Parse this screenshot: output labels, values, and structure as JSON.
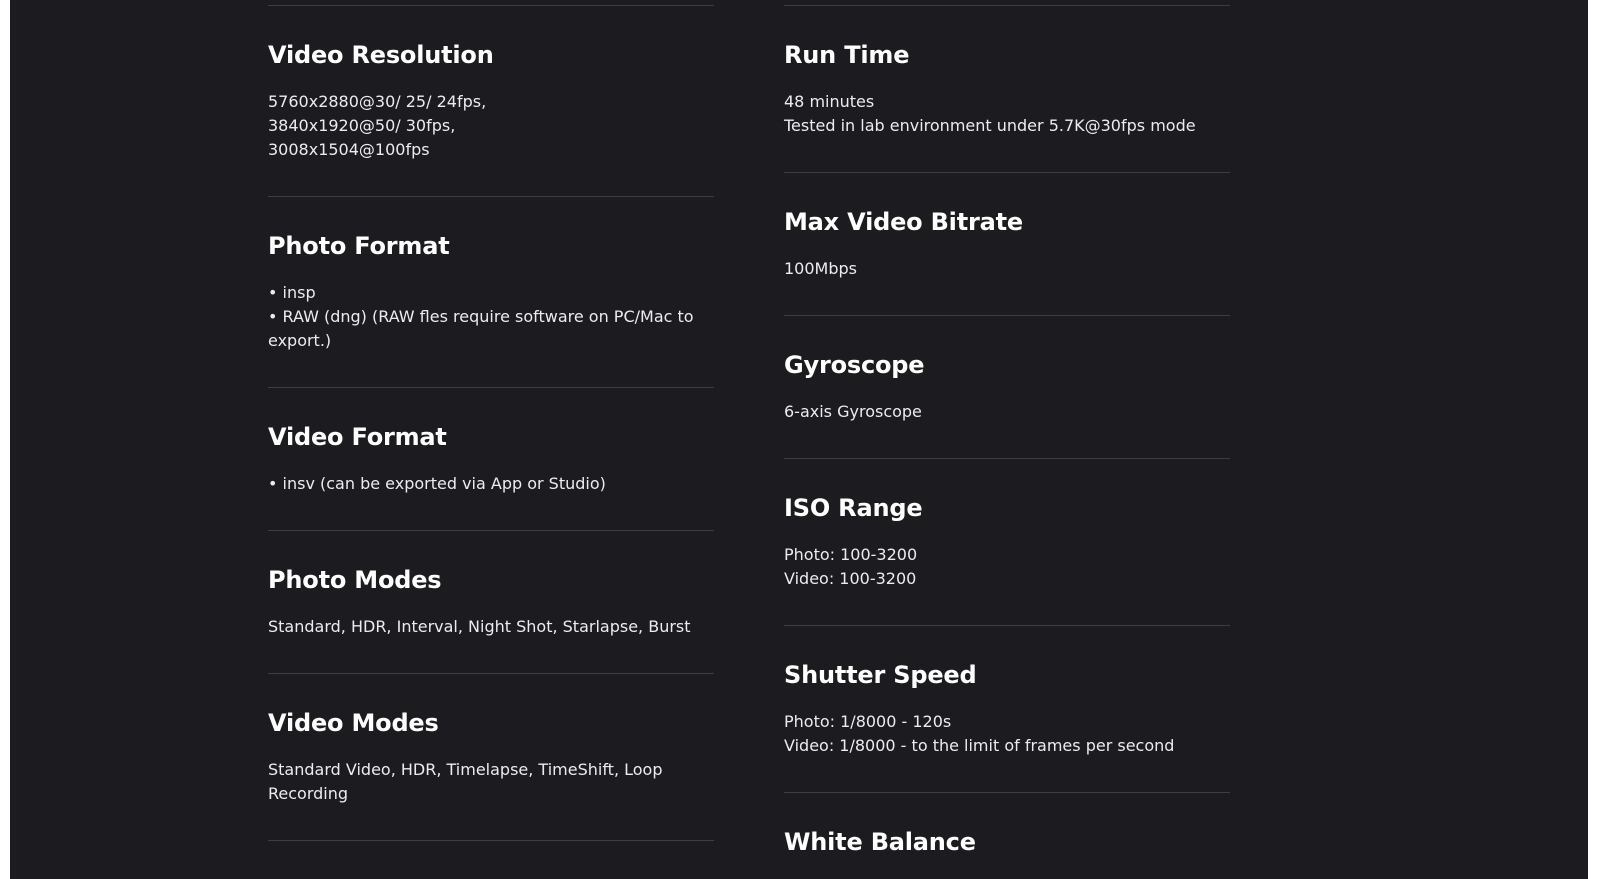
{
  "left_column": [
    {
      "title": "Video Resolution",
      "lines": [
        "5760x2880@30/ 25/ 24fps,",
        "3840x1920@50/ 30fps,",
        "3008x1504@100fps"
      ]
    },
    {
      "title": "Photo Format",
      "lines": [
        "• insp",
        "• RAW (dng) (RAW fles require software on PC/Mac to",
        "export.)"
      ]
    },
    {
      "title": "Video Format",
      "lines": [
        "• insv (can be exported via App or Studio)"
      ]
    },
    {
      "title": "Photo Modes",
      "lines": [
        "Standard, HDR, Interval, Night Shot, Starlapse, Burst"
      ]
    },
    {
      "title": "Video Modes",
      "lines": [
        "Standard Video, HDR, Timelapse, TimeShift, Loop",
        "Recording"
      ]
    }
  ],
  "right_column": [
    {
      "title": "Run Time",
      "lines": [
        "48 minutes",
        "Tested in lab environment under 5.7K@30fps mode"
      ]
    },
    {
      "title": "Max Video Bitrate",
      "lines": [
        "100Mbps"
      ]
    },
    {
      "title": "Gyroscope",
      "lines": [
        "6-axis Gyroscope"
      ]
    },
    {
      "title": "ISO Range",
      "lines": [
        "Photo: 100-3200",
        "Video: 100-3200"
      ]
    },
    {
      "title": "Shutter Speed",
      "lines": [
        "Photo: 1/8000 - 120s",
        "Video: 1/8000 - to the limit of frames per second"
      ]
    },
    {
      "title": "White Balance",
      "lines": []
    }
  ]
}
